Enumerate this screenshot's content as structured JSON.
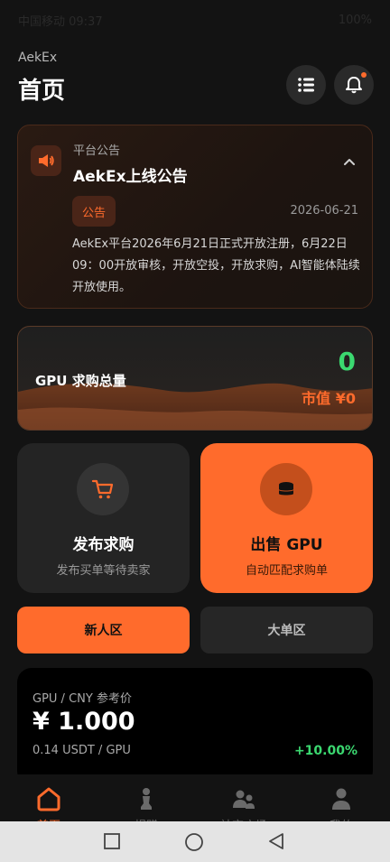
{
  "status_bar": {
    "carrier": "中国移动 09:37",
    "battery": "100%"
  },
  "header": {
    "brand": "AekEx",
    "title": "首页"
  },
  "notice": {
    "section_label": "平台公告",
    "title": "AekEx上线公告",
    "tag": "公告",
    "date": "2026-06-21",
    "body": "AekEx平台2026年6月21日正式开放注册，6月22日09：00开放审核，开放空投，开放求购，AI智能体陆续开放使用。"
  },
  "gpu_summary": {
    "label": "GPU 求购总量",
    "count": "0",
    "market_value": "市值 ¥0"
  },
  "actions": {
    "buy": {
      "title": "发布求购",
      "subtitle": "发布买单等待卖家"
    },
    "sell": {
      "title": "出售 GPU",
      "subtitle": "自动匹配求购单"
    }
  },
  "zones": {
    "new_user": "新人区",
    "large_order": "大单区"
  },
  "price_card": {
    "pair": "GPU / CNY 参考价",
    "price": "¥ 1.000",
    "usdt": "0.14 USDT / GPU",
    "change": "+10.00%"
  },
  "tabs": [
    {
      "label": "首页",
      "icon": "home-icon"
    },
    {
      "label": "捐赠",
      "icon": "chess-pawn-icon"
    },
    {
      "label": "社交广场",
      "icon": "social-icon"
    },
    {
      "label": "我的",
      "icon": "user-icon"
    }
  ],
  "colors": {
    "accent": "#ff6b2c",
    "positive": "#3bd870",
    "background": "#131313"
  }
}
